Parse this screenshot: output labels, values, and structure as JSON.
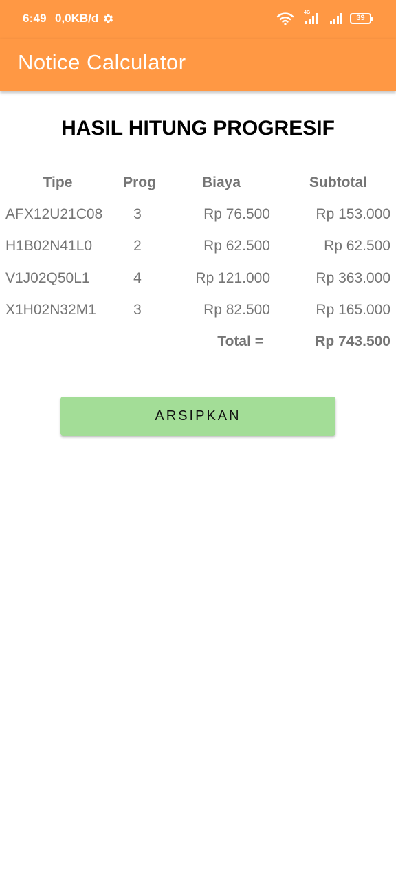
{
  "status_bar": {
    "time": "6:49",
    "speed": "0,0KB/d",
    "network": "4G",
    "battery": "39",
    "icons": [
      "gear-icon",
      "wifi-icon",
      "signal-icon",
      "battery-icon"
    ]
  },
  "app_bar": {
    "title": "Notice Calculator",
    "color": "#FF9844"
  },
  "page": {
    "title": "HASIL HITUNG PROGRESIF"
  },
  "table": {
    "headers": [
      "Tipe",
      "Prog",
      "Biaya",
      "Subtotal"
    ],
    "rows": [
      {
        "tipe": "AFX12U21C08",
        "prog": "3",
        "biaya": "Rp 76.500",
        "subtotal": "Rp 153.000"
      },
      {
        "tipe": "H1B02N41L0",
        "prog": "2",
        "biaya": "Rp 62.500",
        "subtotal": "Rp 62.500"
      },
      {
        "tipe": "V1J02Q50L1",
        "prog": "4",
        "biaya": "Rp 121.000",
        "subtotal": "Rp 363.000"
      },
      {
        "tipe": "X1H02N32M1",
        "prog": "3",
        "biaya": "Rp 82.500",
        "subtotal": "Rp 165.000"
      }
    ],
    "total_label": "Total =",
    "total_value": "Rp 743.500"
  },
  "actions": {
    "archive_label": "ARSIPKAN",
    "archive_color": "#A3DD97"
  }
}
